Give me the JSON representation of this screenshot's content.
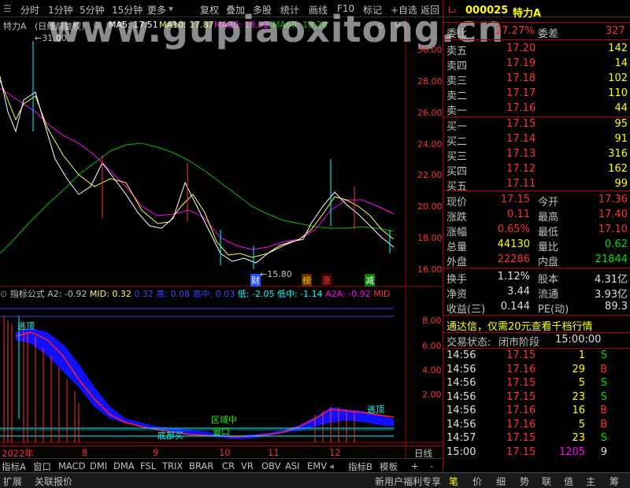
{
  "toolbar": {
    "items": [
      "分时",
      "1分钟",
      "5分钟",
      "15分钟",
      "更多",
      "复权",
      "叠加",
      "多股",
      "统计",
      "画线",
      "F10",
      "标记",
      "+自选",
      "返回"
    ]
  },
  "chart_header": {
    "stock": "特力A",
    "adjust": "(日线前复权)",
    "ma5": "MA5: 17.51",
    "ma10": "MA10: 17.87",
    "ma20": "MA20: 18.92",
    "ma60": "MA60: 18.28",
    "high_mark": "31.00",
    "low_mark": "15.80"
  },
  "watermark": "www.gupiaoxitong.cn",
  "price_axis": [
    "30.00",
    "28.00",
    "26.00",
    "24.00",
    "22.00",
    "20.00",
    "18.00",
    "16.00"
  ],
  "events": [
    "财",
    "榜",
    "涨",
    "减"
  ],
  "indicator_header": {
    "name": "指标公式",
    "a2_label": "A2:",
    "a2": "-0.92",
    "mid_label": "MID:",
    "mid": "0.32",
    "v1": "0.32",
    "high_label": "高:",
    "high": "0.08",
    "highmid_label": "高中:",
    "highmid": "0.03",
    "low_label": "低:",
    "low": "-2.05",
    "lowmid_label": "低中:",
    "lowmid": "-1.14",
    "a2a_label": "A2A:",
    "a2a": "-0.92",
    "mid2": "MID"
  },
  "indicator_axis": [
    "8.00",
    "6.00",
    "4.00",
    "2.00"
  ],
  "indicator_labels": {
    "escape_top": "逃顶",
    "escape_top2": "逃顶",
    "buy_bottom": "底部买",
    "zone": "区域中",
    "zone2": "窗口"
  },
  "time_axis": {
    "year": "2022年",
    "marks": [
      "8",
      "9",
      "10",
      "11",
      "12"
    ],
    "period": "日线"
  },
  "bottom_tabs": [
    "指标A",
    "窗口",
    "MACD",
    "DMI",
    "DMA",
    "FSL",
    "TRIX",
    "BRAR",
    "CR",
    "VR",
    "OBV",
    "ASI",
    "EMV",
    "指标B",
    "模板",
    "+",
    "-"
  ],
  "status_bar": {
    "left": [
      "扩展",
      "关联报价"
    ],
    "promo": "新用户福利专享",
    "right_tabs": [
      "笔",
      "价",
      "细",
      "势",
      "联",
      "值",
      "主",
      "筹"
    ]
  },
  "quote": {
    "code": "000025",
    "name": "特力A",
    "ratio_label": "委比",
    "ratio": "27.27%",
    "diff_label": "委差",
    "diff": "327",
    "asks": [
      {
        "label": "卖五",
        "price": "17.20",
        "vol": "142"
      },
      {
        "label": "卖四",
        "price": "17.19",
        "vol": "14"
      },
      {
        "label": "卖三",
        "price": "17.18",
        "vol": "102"
      },
      {
        "label": "卖二",
        "price": "17.17",
        "vol": "110"
      },
      {
        "label": "卖一",
        "price": "17.16",
        "vol": "44"
      }
    ],
    "bids": [
      {
        "label": "买一",
        "price": "17.15",
        "vol": "95"
      },
      {
        "label": "买二",
        "price": "17.14",
        "vol": "91"
      },
      {
        "label": "买三",
        "price": "17.13",
        "vol": "316"
      },
      {
        "label": "买四",
        "price": "17.12",
        "vol": "162"
      },
      {
        "label": "买五",
        "price": "17.11",
        "vol": "99"
      }
    ],
    "stats": [
      {
        "l1": "现价",
        "v1": "17.15",
        "l2": "今开",
        "v2": "17.36"
      },
      {
        "l1": "涨跌",
        "v1": "0.11",
        "l2": "最高",
        "v2": "17.40"
      },
      {
        "l1": "涨幅",
        "v1": "0.65%",
        "l2": "最低",
        "v2": "17.10"
      },
      {
        "l1": "总量",
        "v1": "44130",
        "l2": "量比",
        "v2": "0.62"
      },
      {
        "l1": "外盘",
        "v1": "22286",
        "l2": "内盘",
        "v2": "21844"
      }
    ],
    "stats2": [
      {
        "l1": "换手",
        "v1": "1.12%",
        "l2": "股本",
        "v2": "4.31亿"
      },
      {
        "l1": "净资",
        "v1": "3.44",
        "l2": "流通",
        "v2": "3.93亿"
      },
      {
        "l1": "收益(三)",
        "v1": "0.144",
        "l2": "PE(动)",
        "v2": "89.3"
      }
    ],
    "banner": "通达信，仅需20元查看千档行情",
    "trade_state_label": "交易状态:",
    "trade_state": "闭市阶段",
    "trade_time": "15:00:00",
    "ticks": [
      {
        "t": "14:56",
        "p": "17.15",
        "v": "1",
        "s": "S"
      },
      {
        "t": "14:56",
        "p": "17.16",
        "v": "29",
        "s": "B"
      },
      {
        "t": "14:56",
        "p": "17.15",
        "v": "5",
        "s": "S"
      },
      {
        "t": "14:56",
        "p": "17.15",
        "v": "23",
        "s": "S"
      },
      {
        "t": "14:56",
        "p": "17.16",
        "v": "16",
        "s": "B"
      },
      {
        "t": "14:56",
        "p": "17.16",
        "v": "5",
        "s": "B"
      },
      {
        "t": "14:57",
        "p": "17.15",
        "v": "23",
        "s": "S"
      },
      {
        "t": "15:00",
        "p": "17.15",
        "v": "1205",
        "s": "9"
      }
    ]
  }
}
